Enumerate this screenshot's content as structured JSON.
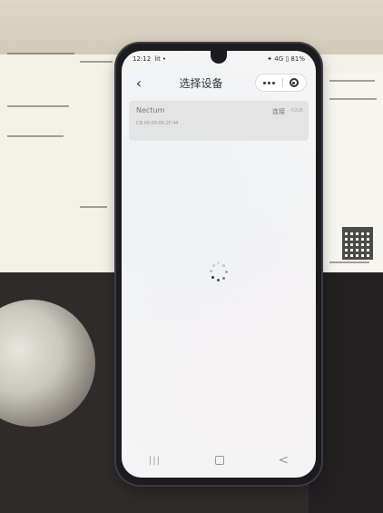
{
  "status_bar": {
    "time": "12:12",
    "left_indicators": "lit •",
    "right_indicators": "✦ 4G ▯ 81%"
  },
  "header": {
    "title": "选择设备",
    "back_icon": "chevron-left-icon",
    "more_icon": "more-dots-icon",
    "close_icon": "target-icon"
  },
  "devices": [
    {
      "name": "Nectum",
      "id": "CB:00:00:00:2F:44",
      "action": "连接",
      "signal": "-52dB"
    }
  ],
  "navigation_bar": {
    "recent": "|||",
    "back": "<"
  }
}
